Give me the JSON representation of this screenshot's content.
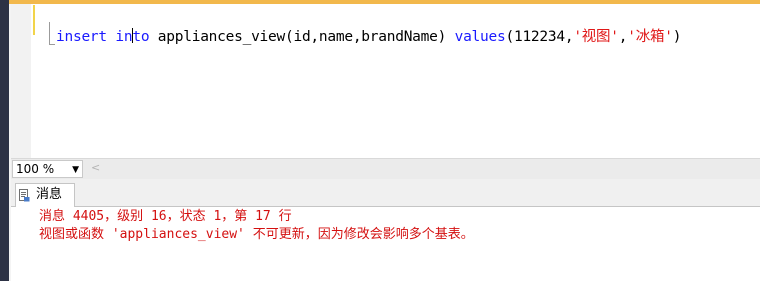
{
  "editor": {
    "tokens": [
      {
        "text": "insert",
        "kind": "kw"
      },
      {
        "text": " ",
        "kind": "ident"
      },
      {
        "text": "in",
        "kind": "kw"
      },
      {
        "text": "to",
        "kind": "kw"
      },
      {
        "text": " appliances_view(id,name,brandName) ",
        "kind": "ident"
      },
      {
        "text": "values",
        "kind": "kw"
      },
      {
        "text": "(112234,",
        "kind": "ident"
      },
      {
        "text": "'视图'",
        "kind": "str"
      },
      {
        "text": ",",
        "kind": "ident"
      },
      {
        "text": "'冰箱'",
        "kind": "str"
      },
      {
        "text": ")",
        "kind": "ident"
      }
    ]
  },
  "status": {
    "zoom": "100 %",
    "zoom_arrow": "▼",
    "scroll_left_arrow": "<"
  },
  "results": {
    "tab_messages": "消息",
    "message_line1": "消息 4405，级别 16，状态 1，第 17 行",
    "message_line2": "视图或函数 'appliances_view' 不可更新，因为修改会影响多个基表。"
  },
  "colors": {
    "keyword": "#1a1aff",
    "string": "#e01818",
    "error": "#d41010",
    "top_accent": "#f2b84c"
  }
}
